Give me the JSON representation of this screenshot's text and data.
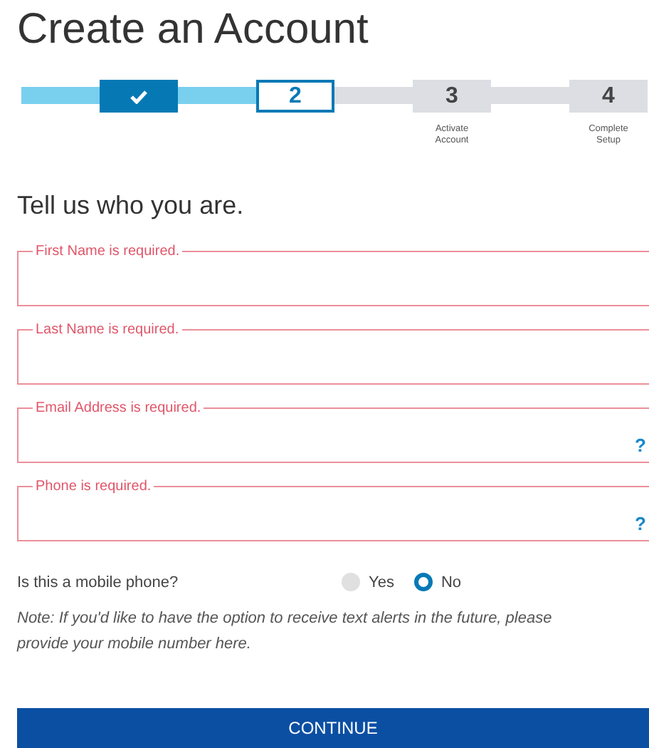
{
  "title": "Create an Account",
  "steps": [
    {
      "done": true,
      "selected": false
    },
    {
      "number": "2",
      "done": false,
      "selected": true
    },
    {
      "number": "3",
      "done": false,
      "selected": false,
      "label": "Activate Account"
    },
    {
      "number": "4",
      "done": false,
      "selected": false,
      "label": "Complete Setup"
    }
  ],
  "heading": "Tell us who you are.",
  "fields": [
    {
      "error": "First Name is required."
    },
    {
      "error": "Last Name is required."
    },
    {
      "error": "Email Address is required.",
      "help_text": "?"
    },
    {
      "error": "Phone is required.",
      "help_text": "?"
    }
  ],
  "mobile_question": {
    "label": "Is this a mobile phone?",
    "options": [
      {
        "label": "Yes",
        "selected": false
      },
      {
        "label": "No",
        "selected": true
      }
    ]
  },
  "note": "Note: If you'd like to have the option to receive text alerts in the future, please provide your mobile number here.",
  "button": "CONTINUE"
}
